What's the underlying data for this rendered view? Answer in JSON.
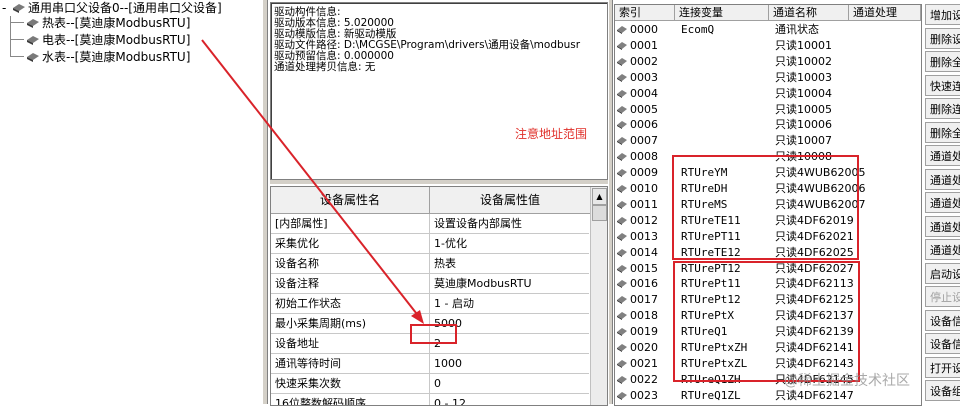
{
  "tree": {
    "root": "通用串口父设备0--[通用串口父设备]",
    "children": [
      "热表--[莫迪康ModbusRTU]",
      "电表--[莫迪康ModbusRTU]",
      "水表--[莫迪康ModbusRTU]"
    ]
  },
  "info": {
    "lines": [
      "驱动构件信息:",
      "驱动版本信息: 5.020000",
      "驱动模版信息: 新驱动模版",
      "驱动文件路径: D:\\MCGSE\\Program\\drivers\\通用设备\\modbusr",
      "驱动预留信息: 0.000000",
      "通道处理拷贝信息: 无"
    ],
    "note": "注意地址范围"
  },
  "props": {
    "headers": [
      "设备属性名",
      "设备属性值"
    ],
    "rows": [
      {
        "name": "[内部属性]",
        "value": "设置设备内部属性"
      },
      {
        "name": "采集优化",
        "value": "1-优化"
      },
      {
        "name": "设备名称",
        "value": "热表"
      },
      {
        "name": "设备注释",
        "value": "莫迪康ModbusRTU"
      },
      {
        "name": "初始工作状态",
        "value": "1 - 启动"
      },
      {
        "name": "最小采集周期(ms)",
        "value": "5000"
      },
      {
        "name": "设备地址",
        "value": "2"
      },
      {
        "name": "通讯等待时间",
        "value": "1000"
      },
      {
        "name": "快速采集次数",
        "value": "0"
      },
      {
        "name": "16位整数解码顺序",
        "value": "0 - 12"
      }
    ]
  },
  "channels": {
    "headers": [
      "索引",
      "连接变量",
      "通道名称",
      "通道处理"
    ],
    "rows": [
      {
        "idx": "0000",
        "var": "EcomQ",
        "name": "通讯状态"
      },
      {
        "idx": "0001",
        "var": "",
        "name": "只读10001"
      },
      {
        "idx": "0002",
        "var": "",
        "name": "只读10002"
      },
      {
        "idx": "0003",
        "var": "",
        "name": "只读10003"
      },
      {
        "idx": "0004",
        "var": "",
        "name": "只读10004"
      },
      {
        "idx": "0005",
        "var": "",
        "name": "只读10005"
      },
      {
        "idx": "0006",
        "var": "",
        "name": "只读10006"
      },
      {
        "idx": "0007",
        "var": "",
        "name": "只读10007"
      },
      {
        "idx": "0008",
        "var": "",
        "name": "只读10008"
      },
      {
        "idx": "0009",
        "var": "RTUreYM",
        "name": "只读4WUB62005"
      },
      {
        "idx": "0010",
        "var": "RTUreDH",
        "name": "只读4WUB62006"
      },
      {
        "idx": "0011",
        "var": "RTUreMS",
        "name": "只读4WUB62007"
      },
      {
        "idx": "0012",
        "var": "RTUreTE11",
        "name": "只读4DF62019"
      },
      {
        "idx": "0013",
        "var": "RTUrePT11",
        "name": "只读4DF62021"
      },
      {
        "idx": "0014",
        "var": "RTUreTE12",
        "name": "只读4DF62025"
      },
      {
        "idx": "0015",
        "var": "RTUrePT12",
        "name": "只读4DF62027"
      },
      {
        "idx": "0016",
        "var": "RTUrePt11",
        "name": "只读4DF62113"
      },
      {
        "idx": "0017",
        "var": "RTUrePt12",
        "name": "只读4DF62125"
      },
      {
        "idx": "0018",
        "var": "RTUrePtX",
        "name": "只读4DF62137"
      },
      {
        "idx": "0019",
        "var": "RTUreQ1",
        "name": "只读4DF62139"
      },
      {
        "idx": "0020",
        "var": "RTUrePtxZH",
        "name": "只读4DF62141"
      },
      {
        "idx": "0021",
        "var": "RTUrePtxZL",
        "name": "只读4DF62143"
      },
      {
        "idx": "0022",
        "var": "RTUreQ1ZH",
        "name": "只读4DF62145"
      },
      {
        "idx": "0023",
        "var": "RTUreQ1ZL",
        "name": "只读4DF62147"
      }
    ]
  },
  "buttons": [
    {
      "label": "增加设",
      "disabled": false
    },
    {
      "label": "删除设",
      "disabled": false
    },
    {
      "label": "删除全",
      "disabled": false
    },
    {
      "label": "快速连",
      "disabled": false
    },
    {
      "label": "删除连",
      "disabled": false
    },
    {
      "label": "删除全",
      "disabled": false
    },
    {
      "label": "通道处",
      "disabled": false
    },
    {
      "label": "通道处",
      "disabled": false
    },
    {
      "label": "通道处",
      "disabled": false
    },
    {
      "label": "通道处",
      "disabled": false
    },
    {
      "label": "通道处",
      "disabled": false
    },
    {
      "label": "启动设",
      "disabled": false
    },
    {
      "label": "停止设",
      "disabled": true
    },
    {
      "label": "设备信",
      "disabled": false
    },
    {
      "label": "设备信",
      "disabled": false
    },
    {
      "label": "打开设",
      "disabled": false
    },
    {
      "label": "设备组",
      "disabled": false
    }
  ],
  "watermark": "@稀土掘金技术社区",
  "colors": {
    "annotation": "#d9232a",
    "note": "#e0302a"
  }
}
